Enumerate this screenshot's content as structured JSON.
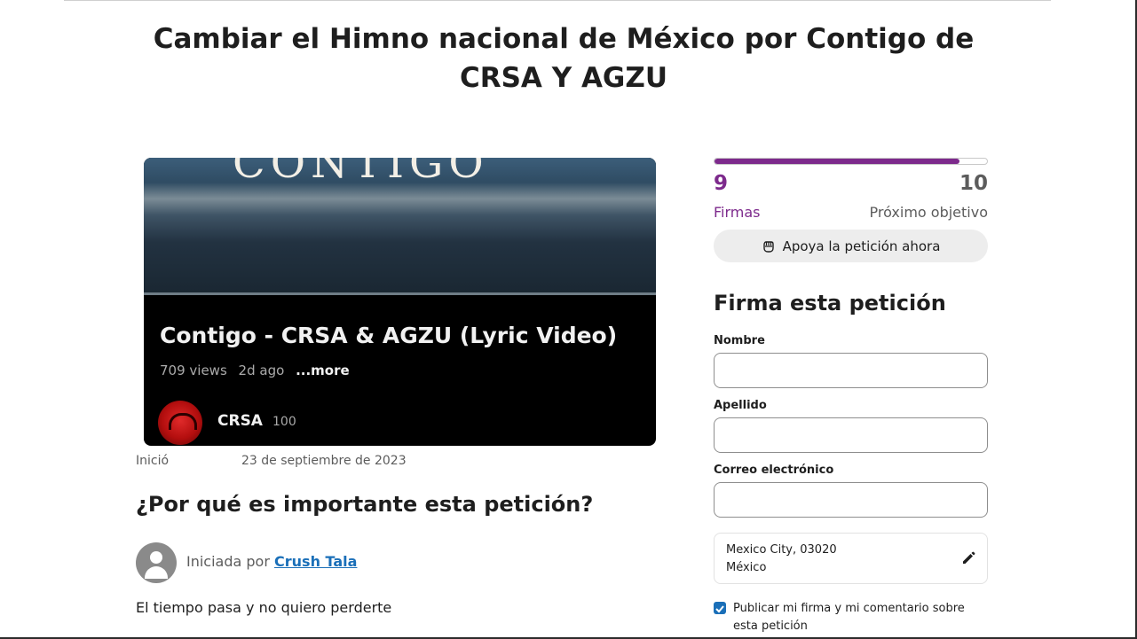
{
  "petition": {
    "title": "Cambiar el Himno nacional de México por Contigo de CRSA Y AGZU",
    "started_label": "Inició",
    "started_date": "23 de septiembre de 2023",
    "why_heading": "¿Por qué es importante esta petición?",
    "author_prefix": "Iniciada por",
    "author_name": "Crush Tala",
    "body_text": "El tiempo pasa y no quiero perderte"
  },
  "video": {
    "thumbnail_text": "CONTIGO",
    "title": "Contigo - CRSA & AGZU (Lyric Video)",
    "views": "709 views",
    "age": "2d ago",
    "more": "...more",
    "channel_name": "CRSA",
    "channel_count": "100"
  },
  "progress": {
    "signatures": "9",
    "signatures_label": "Firmas",
    "goal": "10",
    "goal_label": "Próximo objetivo",
    "fraction": 0.9,
    "color": "#7d2a8c"
  },
  "support": {
    "label": "Apoya la petición ahora",
    "icon": "fist-icon"
  },
  "sign_form": {
    "heading": "Firma esta petición",
    "first_name_label": "Nombre",
    "last_name_label": "Apellido",
    "email_label": "Correo electrónico",
    "location_line1": "Mexico City, 03020",
    "location_line2": "México",
    "publish_label": "Publicar mi firma y mi comentario sobre esta petición",
    "publish_checked": true
  }
}
